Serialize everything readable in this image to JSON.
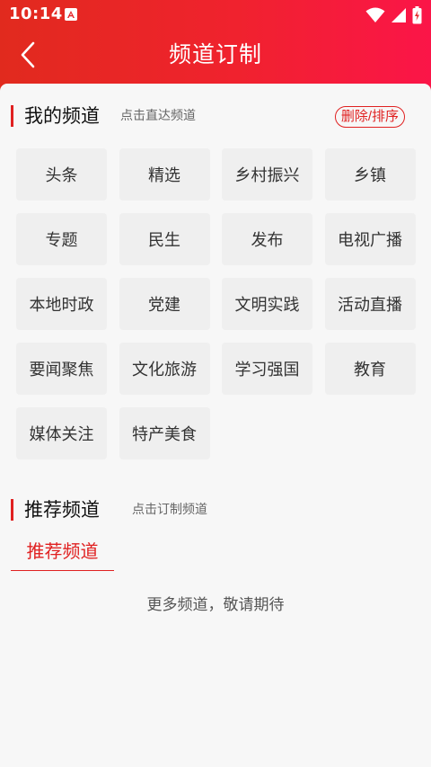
{
  "status_bar": {
    "time": "10:14"
  },
  "header": {
    "title": "频道订制"
  },
  "my_channels": {
    "title": "我的频道",
    "hint": "点击直达频道",
    "edit_label": "删除/排序",
    "items": [
      "头条",
      "精选",
      "乡村振兴",
      "乡镇",
      "专题",
      "民生",
      "发布",
      "电视广播",
      "本地时政",
      "党建",
      "文明实践",
      "活动直播",
      "要闻聚焦",
      "文化旅游",
      "学习强国",
      "教育",
      "媒体关注",
      "特产美食"
    ]
  },
  "recommended": {
    "title": "推荐频道",
    "hint": "点击订制频道",
    "tab_label": "推荐频道",
    "empty_text": "更多频道，敬请期待"
  },
  "colors": {
    "accent": "#e02121",
    "header_start": "#e12a1e",
    "header_end": "#fb1548",
    "chip_bg": "#efefef"
  }
}
